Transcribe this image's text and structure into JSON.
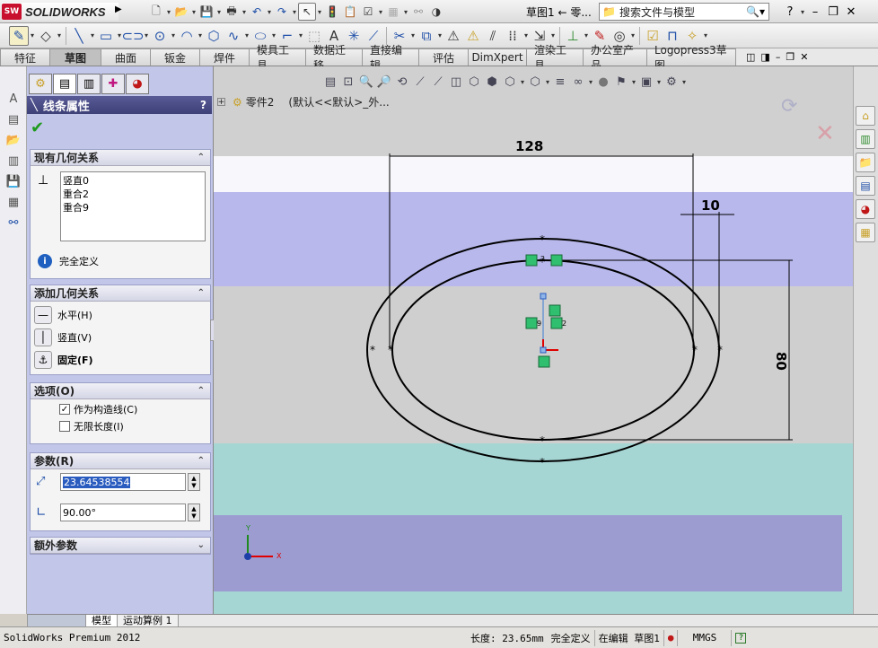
{
  "app": {
    "name": "SOLIDWORKS",
    "logo_abbr": "SW",
    "title": "草图1 ← 零...",
    "search_placeholder": "搜索文件与模型"
  },
  "command_tabs": [
    "特征",
    "草图",
    "曲面",
    "钣金",
    "焊件",
    "模具工具",
    "数据迁移",
    "直接编辑",
    "评估",
    "DimXpert",
    "渲染工具",
    "办公室产品",
    "Logopress3草图"
  ],
  "active_tab": "草图",
  "property_manager": {
    "title": "线条属性",
    "help": "?",
    "existing_relations": {
      "header": "现有几何关系",
      "items": [
        "竖直0",
        "重合2",
        "重合9"
      ],
      "status": "完全定义"
    },
    "add_relations": {
      "header": "添加几何关系",
      "horizontal": "水平(H)",
      "vertical": "竖直(V)",
      "fix": "固定(F)"
    },
    "options": {
      "header": "选项(O)",
      "construction": "作为构造线(C)",
      "construction_checked": true,
      "infinite": "无限长度(I)",
      "infinite_checked": false
    },
    "parameters": {
      "header": "参数(R)",
      "length": "23.64538554",
      "angle": "90.00°"
    },
    "extra": {
      "header": "额外参数"
    }
  },
  "breadcrumb": {
    "part": "零件2",
    "config": "(默认<<默认>_外..."
  },
  "dimensions": {
    "width": "128",
    "offset": "10",
    "height": "80"
  },
  "relation_badges": [
    "2",
    "9",
    "2"
  ],
  "axis_labels": {
    "x": "X",
    "y": "Y"
  },
  "bottom_tabs": [
    "模型",
    "运动算例 1"
  ],
  "status": {
    "product": "SolidWorks Premium 2012",
    "length": "长度: 23.65mm",
    "defined": "完全定义",
    "editing": "在编辑 草图1",
    "units": "MMGS",
    "help": "?"
  }
}
